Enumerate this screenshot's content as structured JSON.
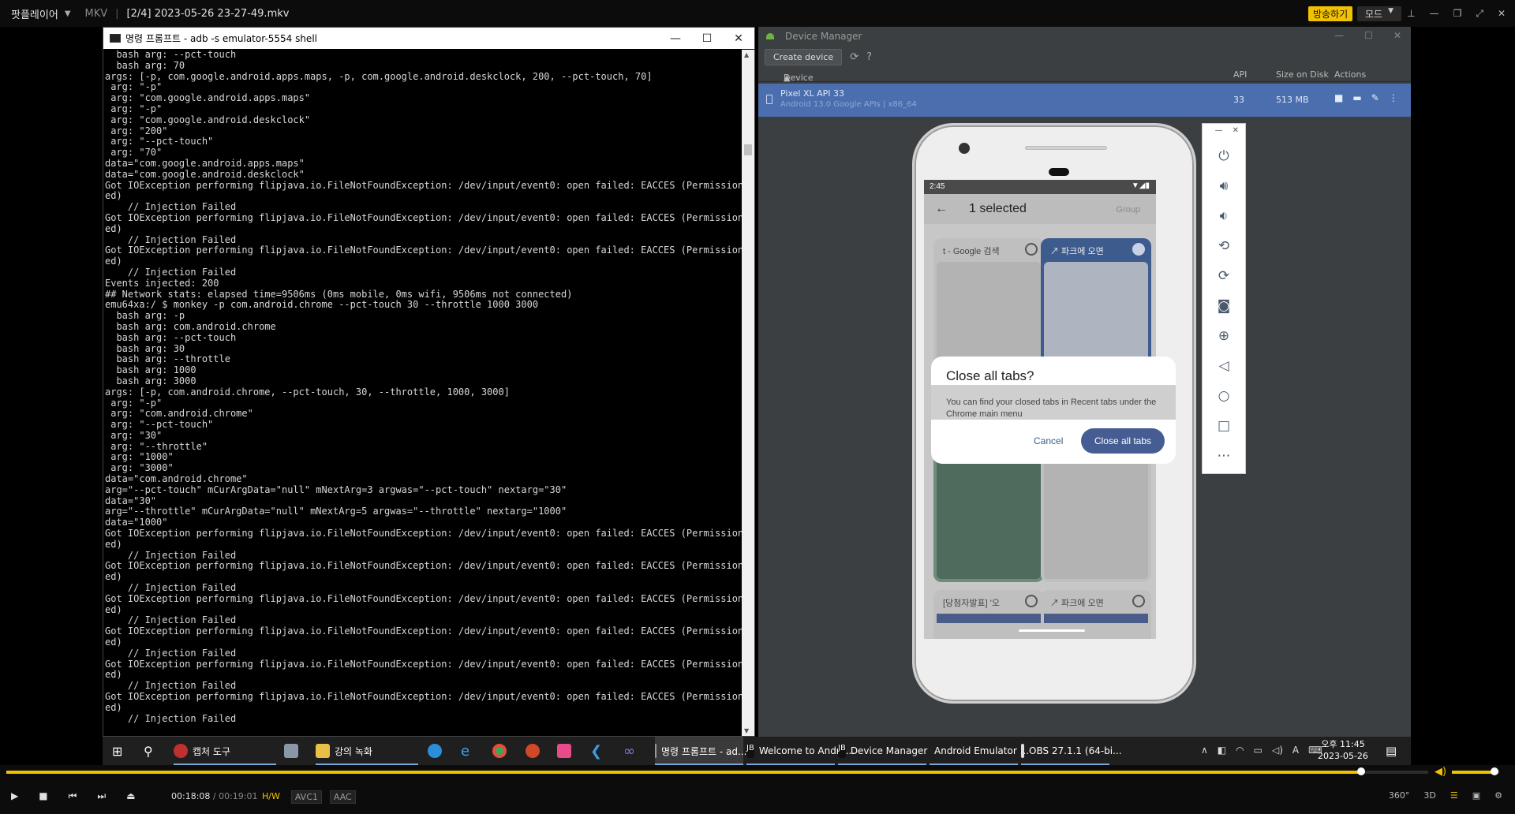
{
  "player": {
    "app_name": "팟플레이어",
    "format": "MKV",
    "file_title": "[2/4] 2023-05-26 23-27-49.mkv",
    "live_button": "방송하기",
    "mode_button": "모드",
    "current_time": "00:18:08",
    "total_time": "/ 00:19:01",
    "tags": [
      "H/W",
      "AVC1",
      "AAC"
    ],
    "progress_fraction": 0.953,
    "volume_fraction": 0.9,
    "right_controls": [
      "360°",
      "3D"
    ],
    "accent_color": "#f2c200"
  },
  "cmd": {
    "title": "명령 프롬프트 - adb  -s emulator-5554 shell",
    "lines": [
      "  bash arg: --pct-touch",
      "  bash arg: 70",
      "args: [-p, com.google.android.apps.maps, -p, com.google.android.deskclock, 200, --pct-touch, 70]",
      " arg: \"-p\"",
      " arg: \"com.google.android.apps.maps\"",
      " arg: \"-p\"",
      " arg: \"com.google.android.deskclock\"",
      " arg: \"200\"",
      " arg: \"--pct-touch\"",
      " arg: \"70\"",
      "data=\"com.google.android.apps.maps\"",
      "data=\"com.google.android.deskclock\"",
      "Got IOException performing flipjava.io.FileNotFoundException: /dev/input/event0: open failed: EACCES (Permission deni",
      "ed)",
      "    // Injection Failed",
      "Got IOException performing flipjava.io.FileNotFoundException: /dev/input/event0: open failed: EACCES (Permission deni",
      "ed)",
      "    // Injection Failed",
      "Got IOException performing flipjava.io.FileNotFoundException: /dev/input/event0: open failed: EACCES (Permission deni",
      "ed)",
      "    // Injection Failed",
      "Events injected: 200",
      "## Network stats: elapsed time=9506ms (0ms mobile, 0ms wifi, 9506ms not connected)",
      "emu64xa:/ $ monkey -p com.android.chrome --pct-touch 30 --throttle 1000 3000",
      "  bash arg: -p",
      "  bash arg: com.android.chrome",
      "  bash arg: --pct-touch",
      "  bash arg: 30",
      "  bash arg: --throttle",
      "  bash arg: 1000",
      "  bash arg: 3000",
      "args: [-p, com.android.chrome, --pct-touch, 30, --throttle, 1000, 3000]",
      " arg: \"-p\"",
      " arg: \"com.android.chrome\"",
      " arg: \"--pct-touch\"",
      " arg: \"30\"",
      " arg: \"--throttle\"",
      " arg: \"1000\"",
      " arg: \"3000\"",
      "data=\"com.android.chrome\"",
      "arg=\"--pct-touch\" mCurArgData=\"null\" mNextArg=3 argwas=\"--pct-touch\" nextarg=\"30\"",
      "data=\"30\"",
      "arg=\"--throttle\" mCurArgData=\"null\" mNextArg=5 argwas=\"--throttle\" nextarg=\"1000\"",
      "data=\"1000\"",
      "Got IOException performing flipjava.io.FileNotFoundException: /dev/input/event0: open failed: EACCES (Permission deni",
      "ed)",
      "    // Injection Failed",
      "Got IOException performing flipjava.io.FileNotFoundException: /dev/input/event0: open failed: EACCES (Permission deni",
      "ed)",
      "    // Injection Failed",
      "Got IOException performing flipjava.io.FileNotFoundException: /dev/input/event0: open failed: EACCES (Permission deni",
      "ed)",
      "    // Injection Failed",
      "Got IOException performing flipjava.io.FileNotFoundException: /dev/input/event0: open failed: EACCES (Permission deni",
      "ed)",
      "    // Injection Failed",
      "Got IOException performing flipjava.io.FileNotFoundException: /dev/input/event0: open failed: EACCES (Permission deni",
      "ed)",
      "    // Injection Failed",
      "Got IOException performing flipjava.io.FileNotFoundException: /dev/input/event0: open failed: EACCES (Permission deni",
      "ed)",
      "    // Injection Failed"
    ]
  },
  "device_manager": {
    "title": "Device Manager",
    "create_button": "Create device",
    "columns": [
      "Device",
      "API",
      "Size on Disk",
      "Actions"
    ],
    "device": {
      "name": "Pixel XL API 33",
      "sub": "Android 13.0 Google APIs | x86_64",
      "api": "33",
      "size": "513 MB"
    }
  },
  "phone": {
    "time": "2:45",
    "header": "1 selected",
    "group": "Group",
    "tabs": [
      {
        "title": "t - Google 검색",
        "selected": false
      },
      {
        "title": "↗ 파크에 오면",
        "selected": true
      },
      {
        "title": "[당첨자발표] '오",
        "selected": false
      },
      {
        "title": "↗ 파크에 오면",
        "selected": false
      }
    ],
    "dialog": {
      "title": "Close all tabs?",
      "message": "You can find your closed tabs in Recent tabs under the Chrome main menu",
      "cancel": "Cancel",
      "confirm": "Close all tabs"
    }
  },
  "taskbar": {
    "items": [
      {
        "label": "캡처 도구"
      },
      {
        "label": "강의 녹화"
      },
      {
        "label": "명령 프롬프트 - ad..."
      },
      {
        "label": "Welcome to Andro..."
      },
      {
        "label": "Device Manager"
      },
      {
        "label": "Android Emulator ..."
      },
      {
        "label": "OBS 27.1.1 (64-bi..."
      }
    ],
    "clock_time": "오후 11:45",
    "clock_date": "2023-05-26",
    "ime": "A"
  }
}
